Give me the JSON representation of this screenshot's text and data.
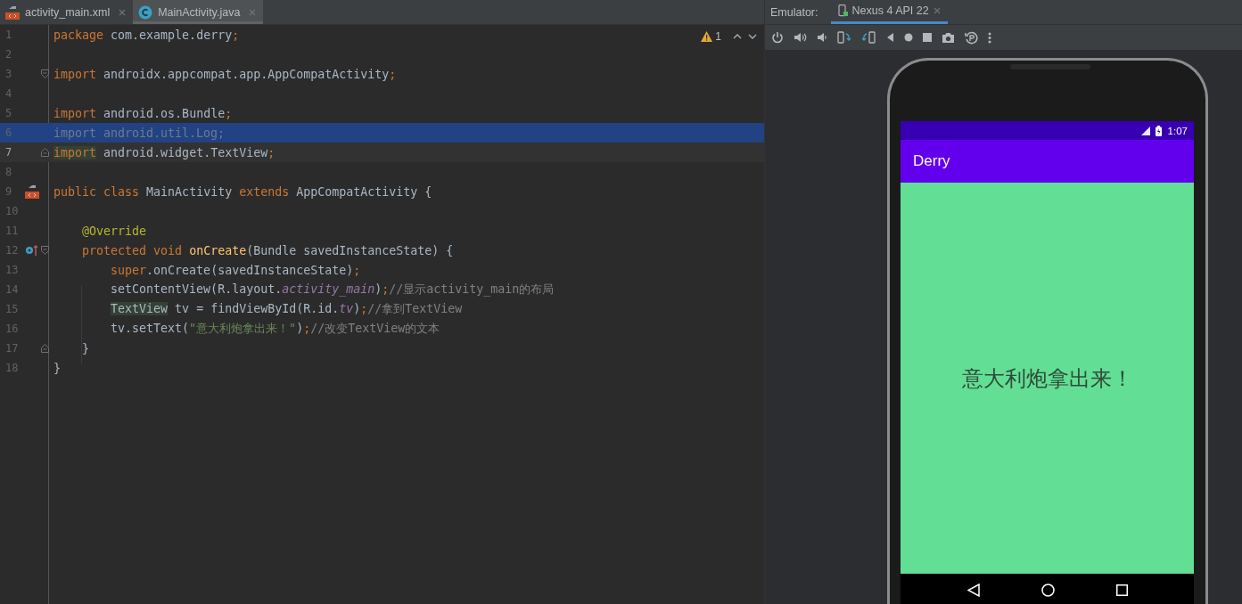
{
  "editor_tabs": [
    {
      "label": "activity_main.xml",
      "kind": "xml",
      "selected": false
    },
    {
      "label": "MainActivity.java",
      "kind": "java",
      "selected": true
    }
  ],
  "inspection": {
    "warning_count": "1"
  },
  "code_lines": [
    {
      "number": "1",
      "selected": false,
      "current": false,
      "tokens": [
        {
          "kind": "keyword",
          "text": "package"
        },
        {
          "kind": "plain",
          "text": " com.example.derry"
        },
        {
          "kind": "semi",
          "text": ";"
        }
      ]
    },
    {
      "number": "2",
      "selected": false,
      "current": false
    },
    {
      "number": "3",
      "selected": false,
      "current": false,
      "fold_marker": {
        "kind": "start"
      },
      "tokens": [
        {
          "kind": "keyword",
          "text": "import"
        },
        {
          "kind": "plain",
          "text": " androidx.appcompat.app.AppCompatActivity"
        },
        {
          "kind": "semi",
          "text": ";"
        }
      ]
    },
    {
      "number": "4",
      "selected": false,
      "current": false
    },
    {
      "number": "5",
      "selected": false,
      "current": false,
      "tokens": [
        {
          "kind": "keyword",
          "text": "import"
        },
        {
          "kind": "plain",
          "text": " android.os.Bundle"
        },
        {
          "kind": "semi",
          "text": ";"
        }
      ]
    },
    {
      "number": "6",
      "selected": true,
      "current": false,
      "tokens": [
        {
          "kind": "unused",
          "text": "import android.util.Log;"
        }
      ]
    },
    {
      "number": "7",
      "selected": false,
      "current": true,
      "fold_marker": {
        "kind": "end"
      },
      "tokens": [
        {
          "kind": "keyword_highlight",
          "text": "import"
        },
        {
          "kind": "plain",
          "text": " android.widget.TextView"
        },
        {
          "kind": "semi",
          "text": ";"
        }
      ]
    },
    {
      "number": "8",
      "selected": false,
      "current": false
    },
    {
      "number": "9",
      "selected": false,
      "current": false,
      "gutter_icon": {
        "kind": "layout"
      },
      "tokens": [
        {
          "kind": "keyword",
          "text": "public class"
        },
        {
          "kind": "plain",
          "text": " MainActivity "
        },
        {
          "kind": "keyword",
          "text": "extends"
        },
        {
          "kind": "plain",
          "text": " AppCompatActivity {"
        }
      ]
    },
    {
      "number": "10",
      "selected": false,
      "current": false
    },
    {
      "number": "11",
      "selected": false,
      "current": false,
      "tokens": [
        {
          "kind": "annotation",
          "text": "    @Override"
        }
      ]
    },
    {
      "number": "12",
      "selected": false,
      "current": false,
      "fold_marker": {
        "kind": "start"
      },
      "gutter_icon": {
        "kind": "override"
      },
      "tokens": [
        {
          "kind": "keyword",
          "text": "    protected void"
        },
        {
          "kind": "method",
          "text": " onCreate"
        },
        {
          "kind": "plain",
          "text": "(Bundle savedInstanceState) {"
        }
      ]
    },
    {
      "number": "13",
      "selected": false,
      "current": false,
      "tokens": [
        {
          "kind": "keyword",
          "text": "        super"
        },
        {
          "kind": "plain",
          "text": ".onCreate(savedInstanceState)"
        },
        {
          "kind": "semi",
          "text": ";"
        }
      ]
    },
    {
      "number": "14",
      "selected": false,
      "current": false,
      "tokens": [
        {
          "kind": "plain",
          "text": "        setContentView(R.layout."
        },
        {
          "kind": "field",
          "text": "activity_main"
        },
        {
          "kind": "plain",
          "text": ")"
        },
        {
          "kind": "semi",
          "text": ";"
        },
        {
          "kind": "comment",
          "text": "//显示activity_main的布局"
        }
      ]
    },
    {
      "number": "15",
      "selected": false,
      "current": false,
      "tokens": [
        {
          "kind": "type_highlight",
          "text": "        TextView"
        },
        {
          "kind": "plain",
          "text": " tv = findViewById(R.id."
        },
        {
          "kind": "field",
          "text": "tv"
        },
        {
          "kind": "plain",
          "text": ")"
        },
        {
          "kind": "semi",
          "text": ";"
        },
        {
          "kind": "comment",
          "text": "//拿到TextView"
        }
      ]
    },
    {
      "number": "16",
      "selected": false,
      "current": false,
      "tokens": [
        {
          "kind": "plain",
          "text": "        tv.setText("
        },
        {
          "kind": "string",
          "text": "\"意大利炮拿出来！\""
        },
        {
          "kind": "plain",
          "text": ")"
        },
        {
          "kind": "semi",
          "text": ";"
        },
        {
          "kind": "comment",
          "text": "//改变TextView的文本"
        }
      ]
    },
    {
      "number": "17",
      "selected": false,
      "current": false,
      "fold_marker": {
        "kind": "end"
      },
      "tokens": [
        {
          "kind": "plain",
          "text": "    }"
        }
      ]
    },
    {
      "number": "18",
      "selected": false,
      "current": false,
      "tokens": [
        {
          "kind": "plain",
          "text": "}"
        }
      ]
    }
  ],
  "emulator": {
    "label": "Emulator:",
    "tabs": [
      {
        "label": "Nexus 4 API 22",
        "selected": true
      }
    ]
  },
  "device": {
    "status_time": "1:07",
    "app_title": "Derry",
    "message": "意大利炮拿出来！"
  }
}
